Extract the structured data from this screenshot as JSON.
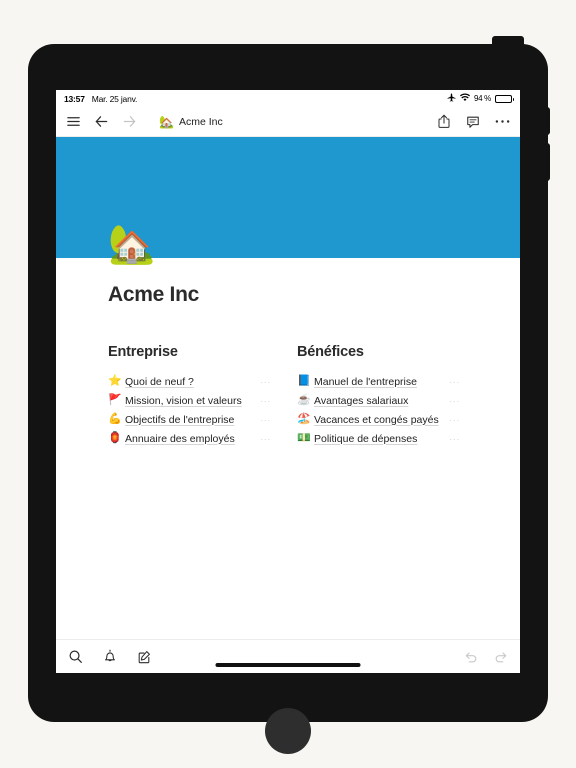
{
  "status_bar": {
    "time": "13:57",
    "date": "Mar. 25 janv.",
    "airplane_icon": "airplane-icon",
    "wifi_icon": "wifi-icon",
    "battery_percent": "94 %",
    "battery_level": 94
  },
  "top_toolbar": {
    "menu_icon": "hamburger-menu-icon",
    "back_icon": "arrow-back-icon",
    "forward_icon": "arrow-forward-icon",
    "breadcrumb": {
      "emoji": "🏡",
      "label": "Acme Inc"
    },
    "share_icon": "share-icon",
    "comment_icon": "comment-icon",
    "more_icon": "more-options-icon"
  },
  "page": {
    "cover_color": "#1f98d0",
    "icon": "🏡",
    "title": "Acme Inc",
    "columns": [
      {
        "heading": "Entreprise",
        "links": [
          {
            "emoji": "⭐",
            "label": "Quoi de neuf ?",
            "more": "···"
          },
          {
            "emoji": "🚩",
            "label": "Mission, vision et valeurs",
            "more": "···"
          },
          {
            "emoji": "💪",
            "label": "Objectifs de l'entreprise",
            "more": "···"
          },
          {
            "emoji": "🏮",
            "label": "Annuaire des employés",
            "more": "···"
          }
        ]
      },
      {
        "heading": "Bénéfices",
        "links": [
          {
            "emoji": "📘",
            "label": "Manuel de l'entreprise",
            "more": "···"
          },
          {
            "emoji": "☕",
            "label": "Avantages salariaux",
            "more": "···"
          },
          {
            "emoji": "🏖️",
            "label": "Vacances et congés payés",
            "more": "···"
          },
          {
            "emoji": "💵",
            "label": "Politique de dépenses",
            "more": "···"
          }
        ]
      }
    ]
  },
  "bottom_toolbar": {
    "search_icon": "search-icon",
    "notifications_icon": "bell-icon",
    "new_page_icon": "compose-icon",
    "undo_icon": "undo-icon",
    "redo_icon": "redo-icon"
  }
}
